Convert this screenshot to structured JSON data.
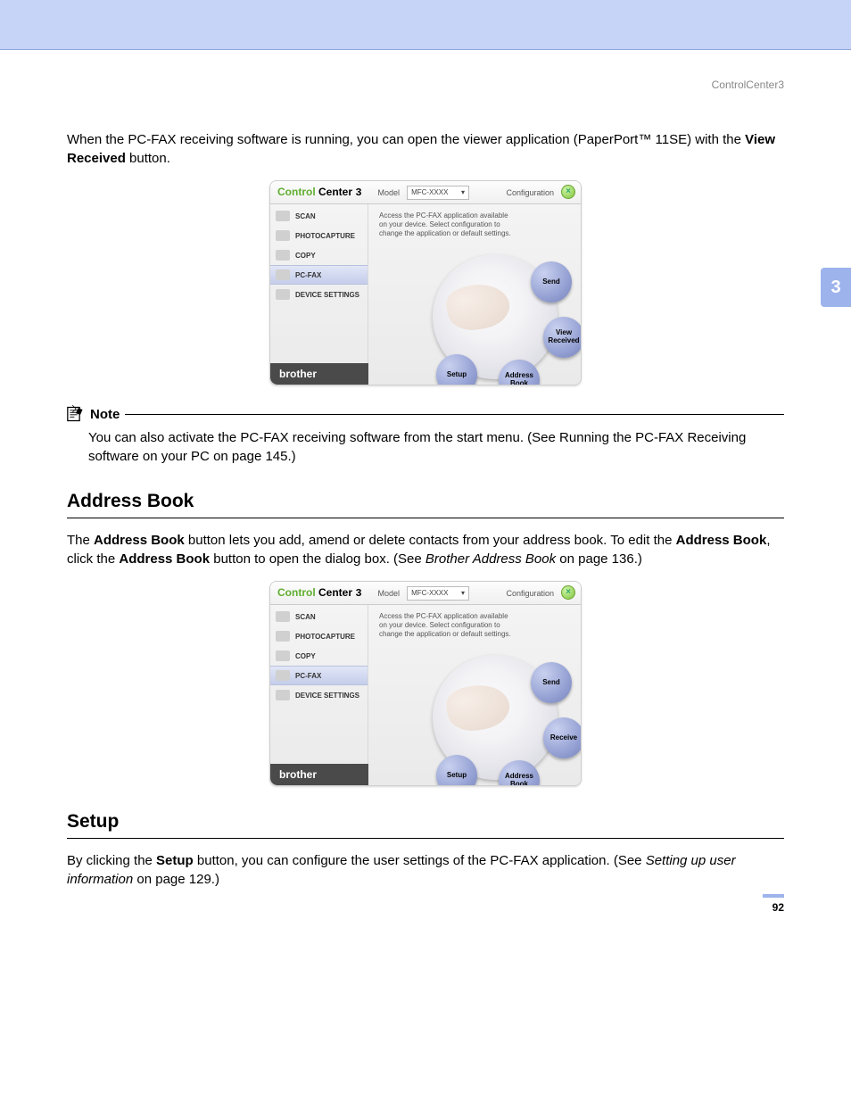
{
  "running_head": "ControlCenter3",
  "chapter_tab": "3",
  "page_number": "92",
  "intro": {
    "pre": "When the PC-FAX receiving software is running, you can open the viewer application (PaperPort™ 11SE) with the ",
    "bold": "View Received",
    "post": " button."
  },
  "note": {
    "label": "Note",
    "pre": "You can also activate the PC-FAX receiving software from the start menu. (See ",
    "xref": "Running the PC-FAX Receiving software on your PC",
    "post": " on page 145.)"
  },
  "section1": {
    "heading": "Address Book",
    "p_pre": "The ",
    "p_b1": "Address Book",
    "p_mid1": " button lets you add, amend or delete contacts from your address book. To edit the ",
    "p_b2": "Address Book",
    "p_mid2": ", click the ",
    "p_b3": "Address Book",
    "p_mid3": " button to open the dialog box. (See ",
    "p_xref": "Brother Address Book",
    "p_post": " on page 136.)"
  },
  "section2": {
    "heading": "Setup",
    "p_pre": "By clicking the ",
    "p_b1": "Setup",
    "p_mid": " button, you can configure the user settings of the PC-FAX application. (See ",
    "p_xref": "Setting up user information",
    "p_post": " on page 129.)"
  },
  "cc": {
    "title_green": "Control",
    "title_rest": " Center ",
    "title_three": "3",
    "model_label": "Model",
    "model_value": "MFC-XXXX",
    "config_label": "Configuration",
    "brand": "brother",
    "desc": "Access the PC-FAX application available on your device. Select configuration to change the application or default settings.",
    "side": [
      "SCAN",
      "PHOTOCAPTURE",
      "COPY",
      "PC-FAX",
      "DEVICE SETTINGS"
    ],
    "orbs_a": [
      "Send",
      "View Received",
      "Address Book",
      "Setup"
    ],
    "orbs_b": [
      "Send",
      "Receive",
      "Address Book",
      "Setup"
    ]
  }
}
